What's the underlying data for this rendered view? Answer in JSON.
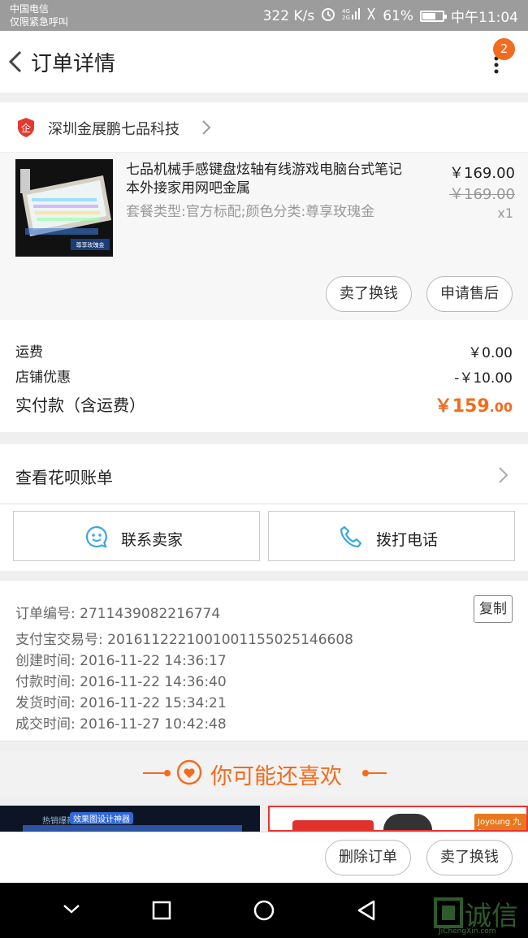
{
  "status_bar": {
    "carrier": "中国电信",
    "emergency": "仅限紧急呼叫",
    "speed": "322 K/s",
    "battery": "61%",
    "time": "中午11:04"
  },
  "nav": {
    "title": "订单详情",
    "badge": "2"
  },
  "shop": {
    "name": "深圳金展鹏七品科技"
  },
  "product": {
    "title": "七品机械手感键盘炫轴有线游戏电脑台式笔记本外接家用网吧金属",
    "spec": "套餐类型:官方标配;颜色分类:尊享玫瑰金",
    "price": "￥169.00",
    "original_price": "￥169.00",
    "quantity": "x1",
    "image_caption": "尊享玫瑰金",
    "sell_button": "卖了换钱",
    "aftersale_button": "申请售后"
  },
  "summary": {
    "shipping_label": "运费",
    "shipping_value": "￥0.00",
    "discount_label": "店铺优惠",
    "discount_value": "-￥10.00",
    "total_label": "实付款（含运费）",
    "total_big": "￥159",
    "total_small": ".00"
  },
  "huabei": {
    "label": "查看花呗账单"
  },
  "contact": {
    "seller_label": "联系卖家",
    "phone_label": "拨打电话"
  },
  "order_info": {
    "order_no": "订单编号: 2711439082216774",
    "copy_label": "复制",
    "alipay_no": "支付宝交易号: 2016112221001001155025146608",
    "created": "创建时间: 2016-11-22 14:36:17",
    "paid": "付款时间: 2016-11-22 14:36:40",
    "shipped": "发货时间: 2016-11-22 15:34:21",
    "completed": "成交时间: 2016-11-27 10:42:48"
  },
  "recommend": {
    "title": "你可能还喜欢",
    "left_tag_1": "热销爆款",
    "left_tag_2": "效果图设计神器",
    "right_tag": "Joyoung 九阳"
  },
  "bottom_bar": {
    "delete_label": "删除订单",
    "sell_label": "卖了换钱"
  },
  "watermark": {
    "text": "诚信",
    "sub": "JiChengXin.com"
  },
  "colors": {
    "accent": "#f46b1d",
    "contact_icon": "#3aa7e0"
  }
}
